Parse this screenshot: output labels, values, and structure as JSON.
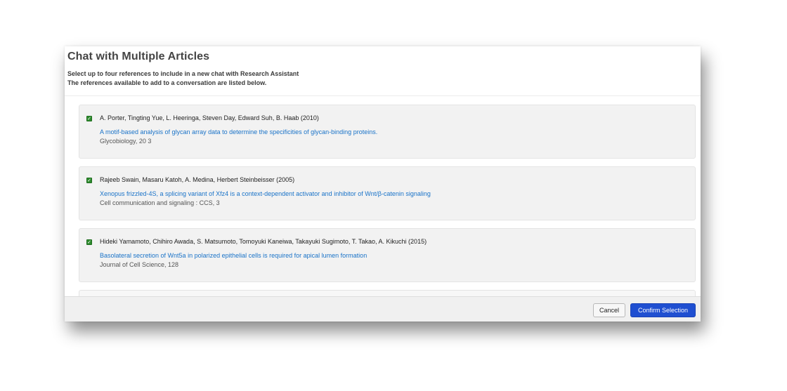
{
  "dialog": {
    "title": "Chat with Multiple Articles",
    "subtitle_line1": "Select up to four references to include in a new chat with Research Assistant",
    "subtitle_line2": "The references available to add to a conversation are listed below."
  },
  "references": [
    {
      "checked": true,
      "authors": "A. Porter, Tingting Yue, L. Heeringa, Steven Day, Edward Suh, B. Haab (2010)",
      "title": "A motif-based analysis of glycan array data to determine the specificities of glycan-binding proteins.",
      "journal": "Glycobiology, 20 3"
    },
    {
      "checked": true,
      "authors": "Rajeeb Swain, Masaru Katoh, A. Medina, Herbert Steinbeisser (2005)",
      "title": "Xenopus frizzled-4S, a splicing variant of Xfz4 is a context-dependent activator and inhibitor of Wnt/β-catenin signaling",
      "journal": "Cell communication and signaling : CCS, 3"
    },
    {
      "checked": true,
      "authors": "Hideki Yamamoto, Chihiro Awada, S. Matsumoto, Tomoyuki Kaneiwa, Takayuki Sugimoto, T. Takao, A. Kikuchi (2015)",
      "title": "Basolateral secretion of Wnt5a in polarized epithelial cells is required for apical lumen formation",
      "journal": "Journal of Cell Science, 128"
    }
  ],
  "footer": {
    "cancel_label": "Cancel",
    "confirm_label": "Confirm Selection"
  },
  "colors": {
    "checkbox": "#2e8b2e",
    "link": "#1a73c8",
    "primary_button": "#1f4fd1"
  }
}
